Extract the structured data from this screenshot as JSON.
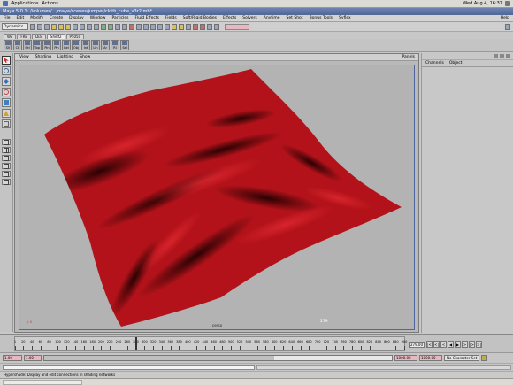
{
  "gnome_panel": {
    "menus": [
      "Applications",
      "Actions"
    ],
    "clock": "Wed Aug 4, 16:37"
  },
  "window": {
    "title": "Maya 5.0.1: /Volumes/.../maya/scenes/jumper/cloth_cube_v3r2.mb*"
  },
  "menubar": {
    "items": [
      "File",
      "Edit",
      "Modify",
      "Create",
      "Display",
      "Window",
      "Particles",
      "Fluid Effects",
      "Fields",
      "Soft/Rigid Bodies",
      "Effects",
      "Solvers",
      "Anytime",
      "Set Shot",
      "Bonus Tools",
      "Syflex"
    ],
    "help": "Help"
  },
  "statusline": {
    "mode": "Dynamics"
  },
  "shelf": {
    "tabs": [
      "Wv",
      "FRB",
      "Dial",
      "Shelf2",
      "P5050"
    ],
    "active_tab": "Shelf2",
    "buttons": [
      "SV",
      "CE",
      "Sel",
      "Top",
      "Pin",
      "Pin",
      "Rel",
      "Obj",
      "Int",
      "Lin",
      "Ar",
      "Rl",
      "Sel"
    ]
  },
  "viewport": {
    "panel_menus": [
      "View",
      "Shading",
      "Lighting",
      "Show"
    ],
    "panels_menu": "Panels",
    "camera": "persp",
    "frame": "279",
    "axis": "y  x"
  },
  "channelbox": {
    "menus": [
      "Channels",
      "Object"
    ]
  },
  "timeslider": {
    "ticks": [
      "1",
      "20",
      "40",
      "60",
      "80",
      "100",
      "120",
      "140",
      "160",
      "180",
      "200",
      "220",
      "240",
      "260",
      "280",
      "300",
      "320",
      "340",
      "360",
      "380",
      "400",
      "420",
      "440",
      "460",
      "480",
      "500",
      "520",
      "540",
      "560",
      "580",
      "600",
      "620",
      "640",
      "660",
      "680",
      "700",
      "720",
      "740",
      "760",
      "780",
      "800",
      "820",
      "840",
      "860",
      "880",
      "900"
    ],
    "start": 1,
    "end": 900,
    "current_frame": 279,
    "current_frame_label": "279.00"
  },
  "rangeslider": {
    "start": "1.00",
    "range_start": "1.00",
    "range_end": "1000.00",
    "end": "1000.00",
    "character": "No Character Set"
  },
  "helpline": {
    "text": "Hypershade: Display and edit connections in shading networks"
  },
  "colors": {
    "cloth": "#b3121a",
    "viewport_bg": "#b3b3b3",
    "frame_border": "#5066a0"
  }
}
